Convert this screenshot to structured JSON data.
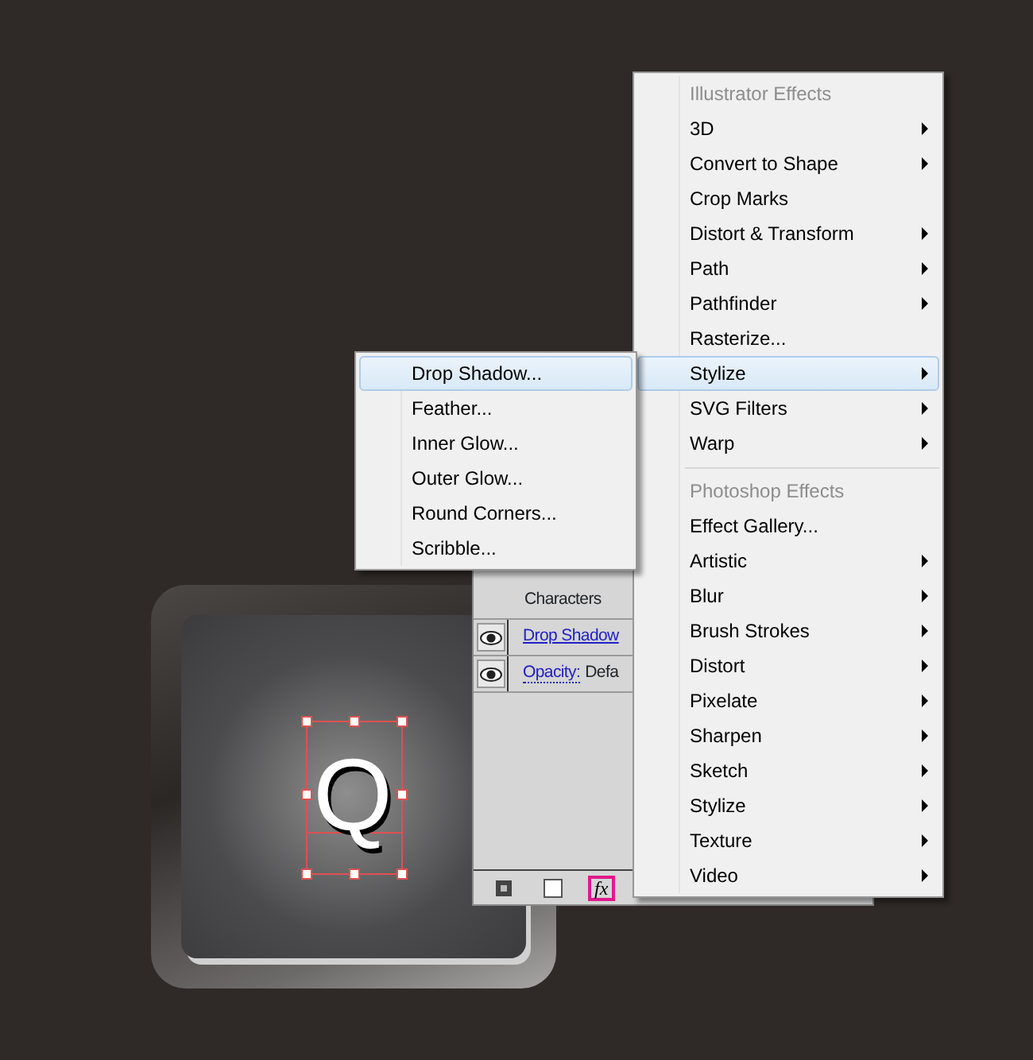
{
  "artwork": {
    "letter": "Q",
    "selected": true
  },
  "appearance_panel": {
    "rows": [
      {
        "kind": "label",
        "text": "Characters"
      },
      {
        "kind": "effect",
        "text": "Drop Shadow"
      },
      {
        "kind": "effect",
        "text": "Opacity:",
        "value": "Defa"
      }
    ],
    "footer_buttons": [
      {
        "kind": "clear",
        "highlighted": false
      },
      {
        "kind": "new",
        "highlighted": false
      },
      {
        "kind": "fx",
        "text": "fx",
        "highlighted": true
      }
    ]
  },
  "effect_menu": {
    "items": [
      {
        "kind": "header",
        "label": "Illustrator Effects"
      },
      {
        "kind": "item",
        "label": "3D",
        "submenu": true,
        "selected": false
      },
      {
        "kind": "item",
        "label": "Convert to Shape",
        "submenu": true,
        "selected": false
      },
      {
        "kind": "item",
        "label": "Crop Marks",
        "submenu": false,
        "selected": false
      },
      {
        "kind": "item",
        "label": "Distort & Transform",
        "submenu": true,
        "selected": false
      },
      {
        "kind": "item",
        "label": "Path",
        "submenu": true,
        "selected": false
      },
      {
        "kind": "item",
        "label": "Pathfinder",
        "submenu": true,
        "selected": false
      },
      {
        "kind": "item",
        "label": "Rasterize...",
        "submenu": false,
        "selected": false
      },
      {
        "kind": "item",
        "label": "Stylize",
        "submenu": true,
        "selected": true
      },
      {
        "kind": "item",
        "label": "SVG Filters",
        "submenu": true,
        "selected": false
      },
      {
        "kind": "item",
        "label": "Warp",
        "submenu": true,
        "selected": false
      },
      {
        "kind": "separator"
      },
      {
        "kind": "header",
        "label": "Photoshop Effects"
      },
      {
        "kind": "item",
        "label": "Effect Gallery...",
        "submenu": false,
        "selected": false
      },
      {
        "kind": "item",
        "label": "Artistic",
        "submenu": true,
        "selected": false
      },
      {
        "kind": "item",
        "label": "Blur",
        "submenu": true,
        "selected": false
      },
      {
        "kind": "item",
        "label": "Brush Strokes",
        "submenu": true,
        "selected": false
      },
      {
        "kind": "item",
        "label": "Distort",
        "submenu": true,
        "selected": false
      },
      {
        "kind": "item",
        "label": "Pixelate",
        "submenu": true,
        "selected": false
      },
      {
        "kind": "item",
        "label": "Sharpen",
        "submenu": true,
        "selected": false
      },
      {
        "kind": "item",
        "label": "Sketch",
        "submenu": true,
        "selected": false
      },
      {
        "kind": "item",
        "label": "Stylize",
        "submenu": true,
        "selected": false
      },
      {
        "kind": "item",
        "label": "Texture",
        "submenu": true,
        "selected": false
      },
      {
        "kind": "item",
        "label": "Video",
        "submenu": true,
        "selected": false
      }
    ]
  },
  "stylize_submenu": {
    "items": [
      {
        "label": "Drop Shadow...",
        "selected": true
      },
      {
        "label": "Feather...",
        "selected": false
      },
      {
        "label": "Inner Glow...",
        "selected": false
      },
      {
        "label": "Outer Glow...",
        "selected": false
      },
      {
        "label": "Round Corners...",
        "selected": false
      },
      {
        "label": "Scribble...",
        "selected": false
      }
    ]
  }
}
